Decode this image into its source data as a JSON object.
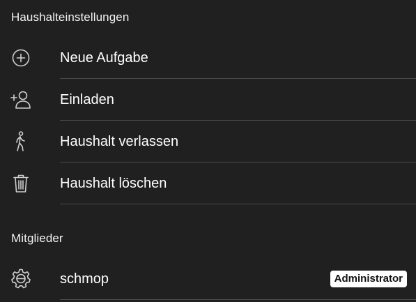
{
  "settings": {
    "title": "Haushalteinstellungen",
    "items": [
      {
        "label": "Neue Aufgabe",
        "icon": "plus-circle-icon"
      },
      {
        "label": "Einladen",
        "icon": "add-user-icon"
      },
      {
        "label": "Haushalt verlassen",
        "icon": "walking-person-icon"
      },
      {
        "label": "Haushalt löschen",
        "icon": "trash-icon"
      }
    ]
  },
  "members": {
    "title": "Mitglieder",
    "items": [
      {
        "name": "schmop",
        "role": "Administrator",
        "icon": "gear-icon"
      }
    ]
  },
  "colors": {
    "background": "#202020",
    "divider": "#4a4a4a",
    "text": "#ffffff",
    "icon": "#cfcfcf",
    "badge_background": "#ffffff",
    "badge_text": "#111111"
  }
}
